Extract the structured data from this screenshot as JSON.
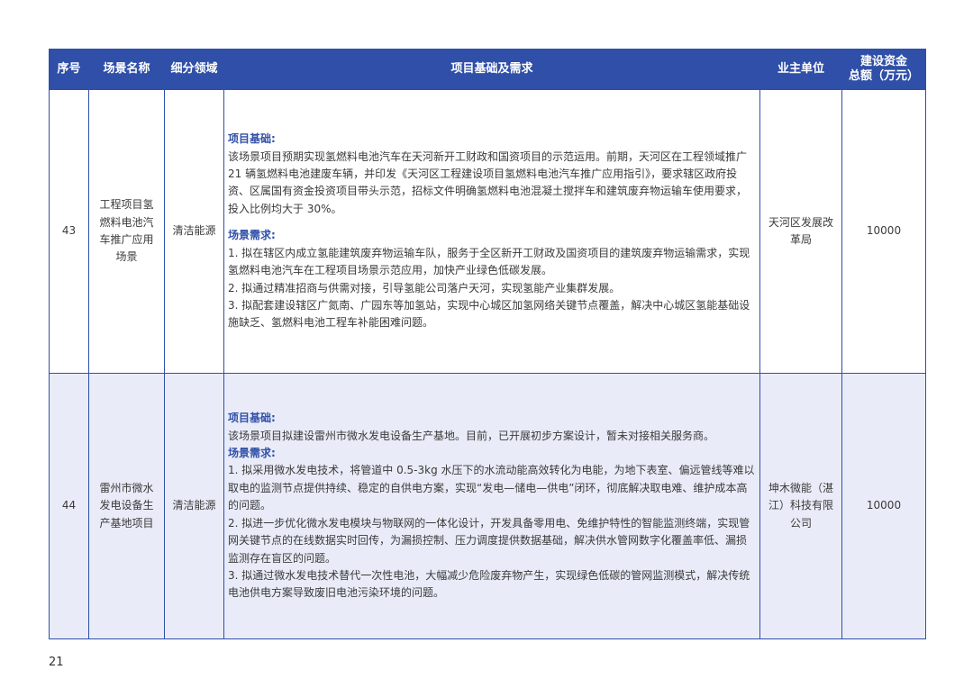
{
  "header": {
    "no": "序号",
    "scene_name": "场景名称",
    "field": "细分领域",
    "basis": "项目基础及需求",
    "owner": "业主单位",
    "fund_line1": "建设资金",
    "fund_line2": "总额（万元）"
  },
  "rows": [
    {
      "no": "43",
      "name": "工程项目氢燃料电池汽车推广应用场景",
      "field": "清洁能源",
      "basis_title": "项目基础:",
      "basis_text": "该场景项目预期实现氢燃料电池汽车在天河新开工财政和国资项目的示范运用。前期，天河区在工程领域推广 21 辆氢燃料电池建废车辆，并印发《天河区工程建设项目氢燃料电池汽车推广应用指引》，要求辖区政府投资、区属国有资金投资项目带头示范，招标文件明确氢燃料电池混凝土搅拌车和建筑废弃物运输车使用要求，投入比例均大于 30%。",
      "needs_title": "场景需求:",
      "needs": [
        "1. 拟在辖区内成立氢能建筑废弃物运输车队，服务于全区新开工财政及国资项目的建筑废弃物运输需求，实现氢燃料电池汽车在工程项目场景示范应用，加快产业绿色低碳发展。",
        "2. 拟通过精准招商与供需对接，引导氢能公司落户天河，实现氢能产业集群发展。",
        "3. 拟配套建设辖区广氮南、广园东等加氢站，实现中心城区加氢网络关键节点覆盖，解决中心城区氢能基础设施缺乏、氢燃料电池工程车补能困难问题。"
      ],
      "owner": "天河区发展改革局",
      "fund": "10000"
    },
    {
      "no": "44",
      "name": "雷州市微水发电设备生产基地项目",
      "field": "清洁能源",
      "basis_title": "项目基础:",
      "basis_text": "该场景项目拟建设雷州市微水发电设备生产基地。目前，已开展初步方案设计，暂未对接相关服务商。",
      "needs_title": "场景需求:",
      "needs": [
        "1. 拟采用微水发电技术，将管道中 0.5-3kg 水压下的水流动能高效转化为电能，为地下表室、偏远管线等难以取电的监测节点提供持续、稳定的自供电方案，实现“发电—储电—供电”闭环，彻底解决取电难、维护成本高的问题。",
        "2. 拟进一步优化微水发电模块与物联网的一体化设计，开发具备零用电、免维护特性的智能监测终端，实现管网关键节点的在线数据实时回传，为漏损控制、压力调度提供数据基础，解决供水管网数字化覆盖率低、漏损监测存在盲区的问题。",
        "3. 拟通过微水发电技术替代一次性电池，大幅减少危险废弃物产生，实现绿色低碳的管网监测模式，解决传统电池供电方案导致废旧电池污染环境的问题。"
      ],
      "owner": "坤木微能（湛江）科技有限公司",
      "fund": "10000"
    }
  ],
  "page_number": "21"
}
